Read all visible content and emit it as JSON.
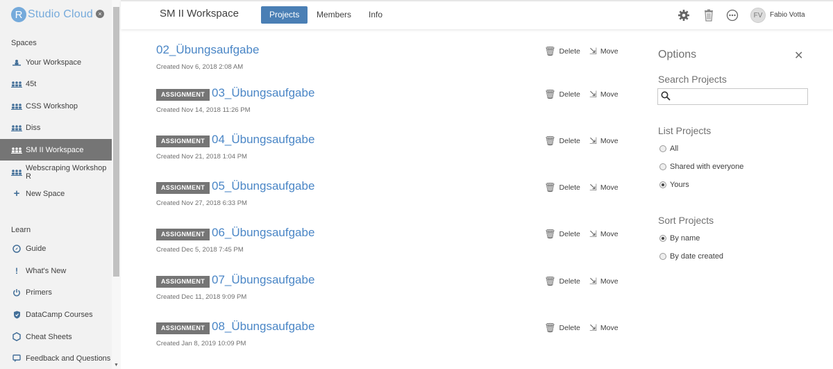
{
  "brand": {
    "logo_letter": "R",
    "name": "Studio Cloud",
    "close_symbol": "×"
  },
  "sidebar": {
    "spaces_label": "Spaces",
    "spaces": [
      {
        "label": "Your Workspace",
        "icon": "workspace-icon"
      },
      {
        "label": "45t",
        "icon": "group-icon"
      },
      {
        "label": "CSS Workshop",
        "icon": "group-icon"
      },
      {
        "label": "Diss",
        "icon": "group-icon"
      },
      {
        "label": "SM II Workspace",
        "icon": "group-icon",
        "active": true
      },
      {
        "label": "Webscraping Workshop R",
        "icon": "group-icon"
      },
      {
        "label": "New Space",
        "icon": "plus-icon"
      }
    ],
    "learn_label": "Learn",
    "learn": [
      {
        "label": "Guide",
        "icon": "compass-icon"
      },
      {
        "label": "What's New",
        "icon": "exclamation-icon"
      },
      {
        "label": "Primers",
        "icon": "power-icon"
      },
      {
        "label": "DataCamp Courses",
        "icon": "shield-icon"
      },
      {
        "label": "Cheat Sheets",
        "icon": "hexagon-icon"
      },
      {
        "label": "Feedback and Questions",
        "icon": "chat-icon"
      }
    ]
  },
  "header": {
    "workspace_title": "SM II Workspace",
    "tabs": [
      {
        "label": "Projects",
        "active": true
      },
      {
        "label": "Members"
      },
      {
        "label": "Info"
      }
    ],
    "user": {
      "initials": "FV",
      "name": "Fabio Votta"
    }
  },
  "projects": [
    {
      "badge": "",
      "title": "02_Übungsaufgabe",
      "created": "Created Nov 6, 2018 2:08 AM"
    },
    {
      "badge": "ASSIGNMENT",
      "title": "03_Übungsaufgabe",
      "created": "Created Nov 14, 2018 11:26 PM"
    },
    {
      "badge": "ASSIGNMENT",
      "title": "04_Übungsaufgabe",
      "created": "Created Nov 21, 2018 1:04 PM"
    },
    {
      "badge": "ASSIGNMENT",
      "title": "05_Übungsaufgabe",
      "created": "Created Nov 27, 2018 6:33 PM"
    },
    {
      "badge": "ASSIGNMENT",
      "title": "06_Übungsaufgabe",
      "created": "Created Dec 5, 2018 7:45 PM"
    },
    {
      "badge": "ASSIGNMENT",
      "title": "07_Übungsaufgabe",
      "created": "Created Dec 11, 2018 9:09 PM"
    },
    {
      "badge": "ASSIGNMENT",
      "title": "08_Übungsaufgabe",
      "created": "Created Jan 8, 2019 10:09 PM"
    }
  ],
  "actions": {
    "delete": "Delete",
    "move": "Move"
  },
  "options": {
    "title": "Options",
    "search_heading": "Search Projects",
    "search_value": "",
    "list_heading": "List Projects",
    "list_options": [
      {
        "label": "All",
        "selected": false
      },
      {
        "label": "Shared with everyone",
        "selected": false
      },
      {
        "label": "Yours",
        "selected": true
      }
    ],
    "sort_heading": "Sort Projects",
    "sort_options": [
      {
        "label": "By name",
        "selected": true
      },
      {
        "label": "By date created",
        "selected": false
      }
    ]
  },
  "colors": {
    "accent": "#4a7fb5",
    "link": "#4a86c6",
    "active_nav": "#757575",
    "badge": "#757575"
  }
}
